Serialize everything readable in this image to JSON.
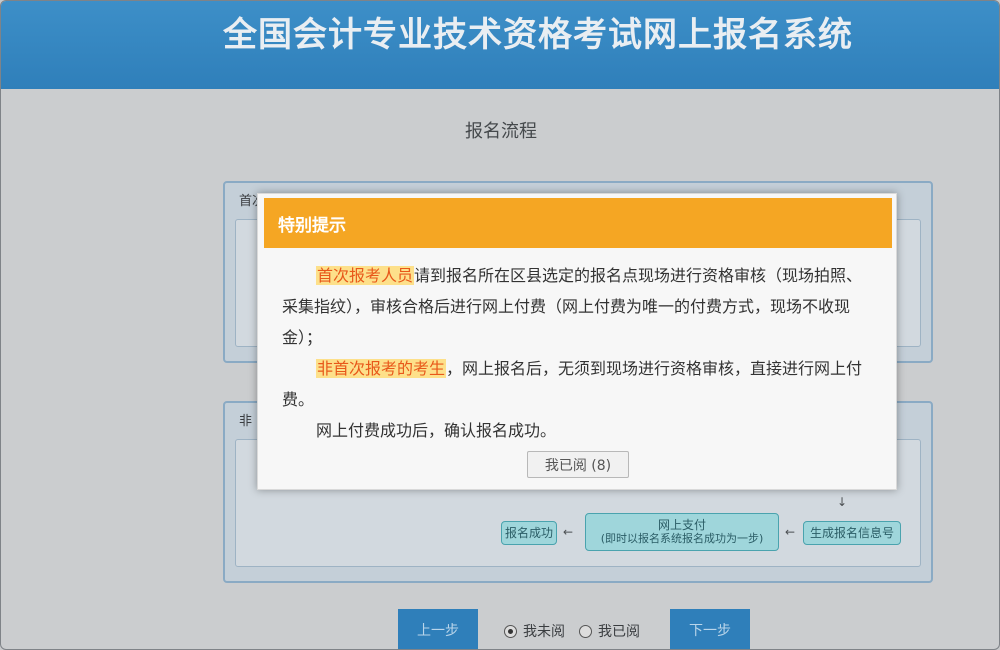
{
  "header": {
    "title": "全国会计专业技术资格考试网上报名系统"
  },
  "section": {
    "title": "报名流程"
  },
  "panels": {
    "panel1_label": "首次",
    "panel2_label": "非"
  },
  "flow_steps": {
    "step_confirm": "报名成功",
    "step_pay_line1": "网上支付",
    "step_pay_line2": "(即时以报名系统报名成功为一步)",
    "step_submit": "生成报名信息号"
  },
  "arrows": {
    "left": "←",
    "down": "↓"
  },
  "footer": {
    "prev_label": "上一步",
    "next_label": "下一步",
    "radio_unread": "我未阅",
    "radio_read": "我已阅"
  },
  "modal": {
    "title": "特别提示",
    "para1_highlight": "首次报考人员",
    "para1_text": "请到报名所在区县选定的报名点现场进行资格审核（现场拍照、采集指纹），审核合格后进行网上付费（网上付费为唯一的付费方式，现场不收现金）；",
    "para2_highlight": "非首次报考的考生",
    "para2_text": "，网上报名后，无须到现场进行资格审核，直接进行网上付费。",
    "para3_text": "网上付费成功后，确认报名成功。",
    "read_button": "我已阅 (8)"
  },
  "colors": {
    "header_blue": "#2f7fba",
    "modal_orange": "#f5a623",
    "highlight_text": "#e8581a"
  }
}
